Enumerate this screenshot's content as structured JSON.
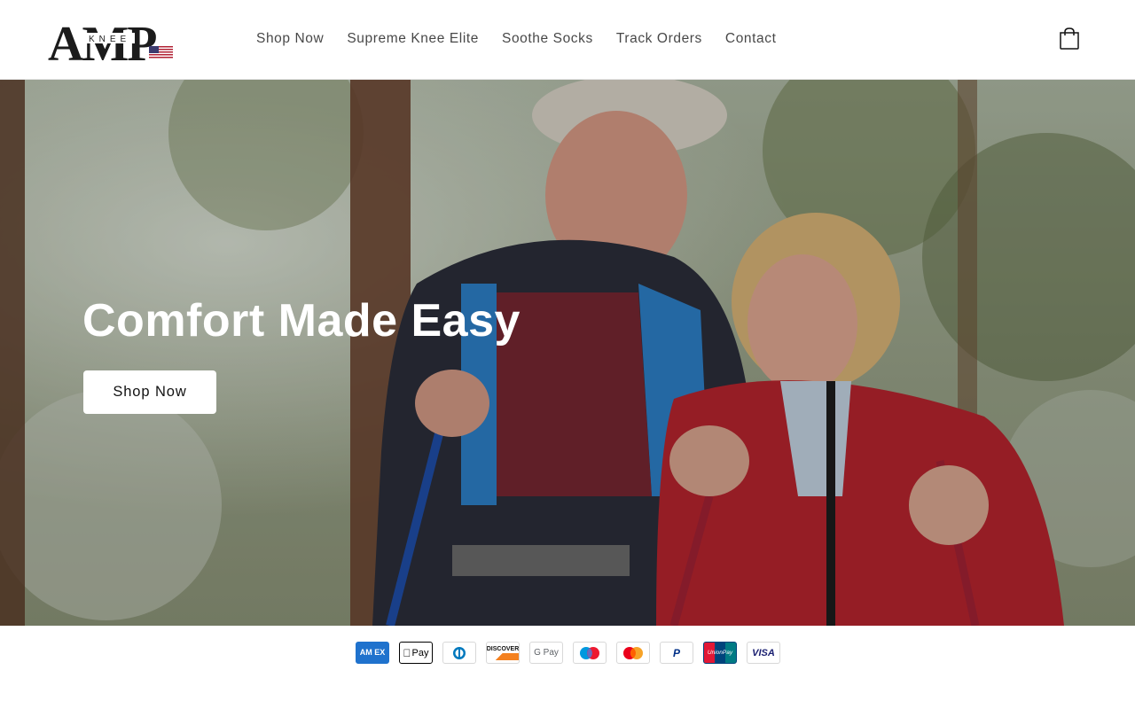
{
  "brand": {
    "logo_text": "AMP",
    "logo_subtext": "KNEE"
  },
  "nav": {
    "items": [
      {
        "label": "Shop Now"
      },
      {
        "label": "Supreme Knee Elite"
      },
      {
        "label": "Soothe Socks"
      },
      {
        "label": "Track Orders"
      },
      {
        "label": "Contact"
      }
    ]
  },
  "hero": {
    "title": "Comfort Made Easy",
    "button_label": "Shop Now"
  },
  "payments": {
    "amex": "AM EX",
    "applepay": "Pay",
    "discover": "DISCOVER",
    "gpay": "G Pay",
    "paypal": "P",
    "unionpay": "UnionPay",
    "visa": "VISA"
  },
  "icons": {
    "cart": "shopping-bag-icon",
    "flag": "us-flag-icon"
  },
  "colors": {
    "amex": "#1f72cd",
    "visa": "#1a1f71",
    "discover": "#f48120",
    "unionpay_red": "#e21836",
    "unionpay_teal": "#00447c",
    "mastercard_red": "#eb001b",
    "mastercard_yellow": "#f79e1b",
    "maestro_blue": "#0099df"
  }
}
